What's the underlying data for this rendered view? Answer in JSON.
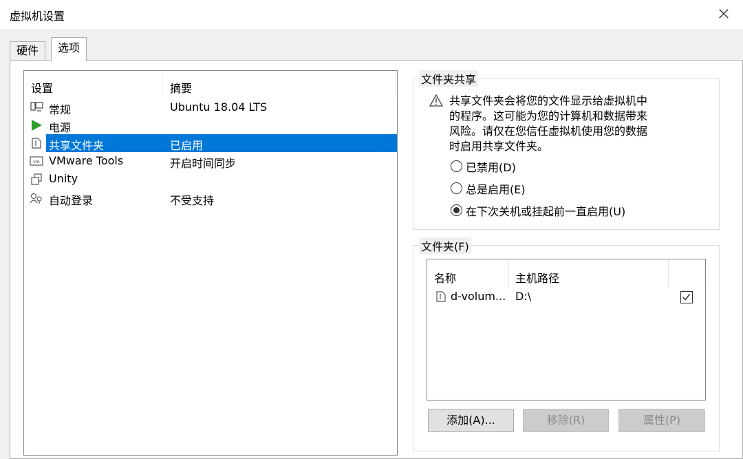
{
  "window": {
    "title": "虚拟机设置",
    "close": "×"
  },
  "tabs": [
    {
      "label": "硬件"
    },
    {
      "label": "选项"
    }
  ],
  "settings": {
    "col_setting": "设置",
    "col_summary": "摘要",
    "rows": [
      {
        "name": "常规",
        "summary": "Ubuntu 18.04 LTS",
        "icon": "general-icon"
      },
      {
        "name": "电源",
        "summary": "",
        "icon": "power-play-icon"
      },
      {
        "name": "共享文件夹",
        "summary": "已启用",
        "icon": "shared-folder-icon",
        "selected": true
      },
      {
        "name": "VMware Tools",
        "summary": "开启时间同步",
        "icon": "vmware-tools-icon"
      },
      {
        "name": "Unity",
        "summary": "",
        "icon": "unity-icon"
      },
      {
        "name": "自动登录",
        "summary": "不受支持",
        "icon": "autologin-icon"
      }
    ]
  },
  "folder_sharing": {
    "title": "文件夹共享",
    "warning_lines": [
      "共享文件夹会将您的文件显示给虚拟机中",
      "的程序。这可能为您的计算机和数据带来",
      "风险。请仅在您信任虚拟机使用您的数据",
      "时启用共享文件夹。"
    ],
    "options": [
      {
        "label": "已禁用(D)",
        "checked": false
      },
      {
        "label": "总是启用(E)",
        "checked": false
      },
      {
        "label": "在下次关机或挂起前一直启用(U)",
        "checked": true
      }
    ]
  },
  "folders": {
    "title": "文件夹(F)",
    "col_name": "名称",
    "col_path": "主机路径",
    "rows": [
      {
        "name": "d-volum...",
        "path": "D:\\",
        "enabled": true
      }
    ],
    "buttons": {
      "add": "添加(A)...",
      "remove": "移除(R)",
      "properties": "属性(P)"
    }
  }
}
